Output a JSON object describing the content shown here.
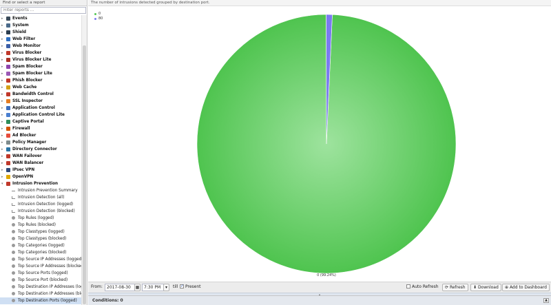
{
  "left_panel": {
    "header": "Find or select a report",
    "filter_placeholder": "Filter reports ...",
    "nodes": [
      {
        "label": "Events",
        "color": "#3a4a5a",
        "kind": "category"
      },
      {
        "label": "System",
        "color": "#4a6a8a",
        "kind": "category"
      },
      {
        "label": "Shield",
        "color": "#2c3e50",
        "kind": "category"
      },
      {
        "label": "Web Filter",
        "color": "#2e6fc2",
        "kind": "category"
      },
      {
        "label": "Web Monitor",
        "color": "#3b5fa8",
        "kind": "category"
      },
      {
        "label": "Virus Blocker",
        "color": "#c0392b",
        "kind": "category"
      },
      {
        "label": "Virus Blocker Lite",
        "color": "#a93226",
        "kind": "category"
      },
      {
        "label": "Spam Blocker",
        "color": "#8e44ad",
        "kind": "category"
      },
      {
        "label": "Spam Blocker Lite",
        "color": "#9b59b6",
        "kind": "category"
      },
      {
        "label": "Phish Blocker",
        "color": "#c0392b",
        "kind": "category"
      },
      {
        "label": "Web Cache",
        "color": "#d4a017",
        "kind": "category"
      },
      {
        "label": "Bandwidth Control",
        "color": "#c0392b",
        "kind": "category"
      },
      {
        "label": "SSL Inspector",
        "color": "#e67e22",
        "kind": "category"
      },
      {
        "label": "Application Control",
        "color": "#3c6fbf",
        "kind": "category"
      },
      {
        "label": "Application Control Lite",
        "color": "#4a7fd0",
        "kind": "category"
      },
      {
        "label": "Captive Portal",
        "color": "#2f8f5b",
        "kind": "category"
      },
      {
        "label": "Firewall",
        "color": "#d35400",
        "kind": "category"
      },
      {
        "label": "Ad Blocker",
        "color": "#e74c3c",
        "kind": "category"
      },
      {
        "label": "Policy Manager",
        "color": "#7f8c8d",
        "kind": "category"
      },
      {
        "label": "Directory Connector",
        "color": "#2874a6",
        "kind": "category"
      },
      {
        "label": "WAN Failover",
        "color": "#c0392b",
        "kind": "category"
      },
      {
        "label": "WAN Balancer",
        "color": "#c0392b",
        "kind": "category"
      },
      {
        "label": "IPsec VPN",
        "color": "#2e4a7a",
        "kind": "category"
      },
      {
        "label": "OpenVPN",
        "color": "#e0a800",
        "kind": "category"
      },
      {
        "label": "Intrusion Prevention",
        "color": "#c0392b",
        "kind": "category-open"
      },
      {
        "label": "Intrusion Prevention Summary",
        "kind": "child-text"
      },
      {
        "label": "Intrusion Detection (all)",
        "kind": "child-bar"
      },
      {
        "label": "Intrusion Detection (logged)",
        "kind": "child-bar"
      },
      {
        "label": "Intrusion Detection (blocked)",
        "kind": "child-bar"
      },
      {
        "label": "Top Rules (logged)",
        "kind": "child-pie"
      },
      {
        "label": "Top Rules (blocked)",
        "kind": "child-pie"
      },
      {
        "label": "Top Classtypes (logged)",
        "kind": "child-pie"
      },
      {
        "label": "Top Classtypes (blocked)",
        "kind": "child-pie"
      },
      {
        "label": "Top Categories (logged)",
        "kind": "child-pie"
      },
      {
        "label": "Top Categories (blocked)",
        "kind": "child-pie"
      },
      {
        "label": "Top Source IP Addresses (logged)",
        "kind": "child-pie"
      },
      {
        "label": "Top Source IP Addresses (blocked)",
        "kind": "child-pie"
      },
      {
        "label": "Top Source Ports (logged)",
        "kind": "child-pie"
      },
      {
        "label": "Top Source Port (blocked)",
        "kind": "child-pie"
      },
      {
        "label": "Top Destination IP Addresses (logged)",
        "kind": "child-pie"
      },
      {
        "label": "Top Destination IP Addresses (blo...",
        "kind": "child-pie"
      },
      {
        "label": "Top Destination Ports (logged)",
        "kind": "child-pie",
        "selected": true
      }
    ]
  },
  "report": {
    "description": "The number of intrusions detected grouped by destination port."
  },
  "chart_data": {
    "type": "pie",
    "slices": [
      {
        "label": "0",
        "value": 99.24,
        "color": "#52c752"
      },
      {
        "label": "80",
        "value": 0.76,
        "color": "#7b7bf0"
      }
    ],
    "data_label": "0 (99.24%)",
    "legend_position": "top-left"
  },
  "toolbar": {
    "from_label": "From:",
    "date_value": "2017-08-30",
    "time_value": "7:30 PM",
    "till_label": "till",
    "present_label": "Present",
    "present_checked": true,
    "auto_refresh_label": "Auto Refresh",
    "auto_refresh_checked": false,
    "refresh_label": "Refresh",
    "download_label": "Download",
    "dashboard_label": "Add to Dashboard"
  },
  "conditions": {
    "label": "Conditions: 0"
  }
}
